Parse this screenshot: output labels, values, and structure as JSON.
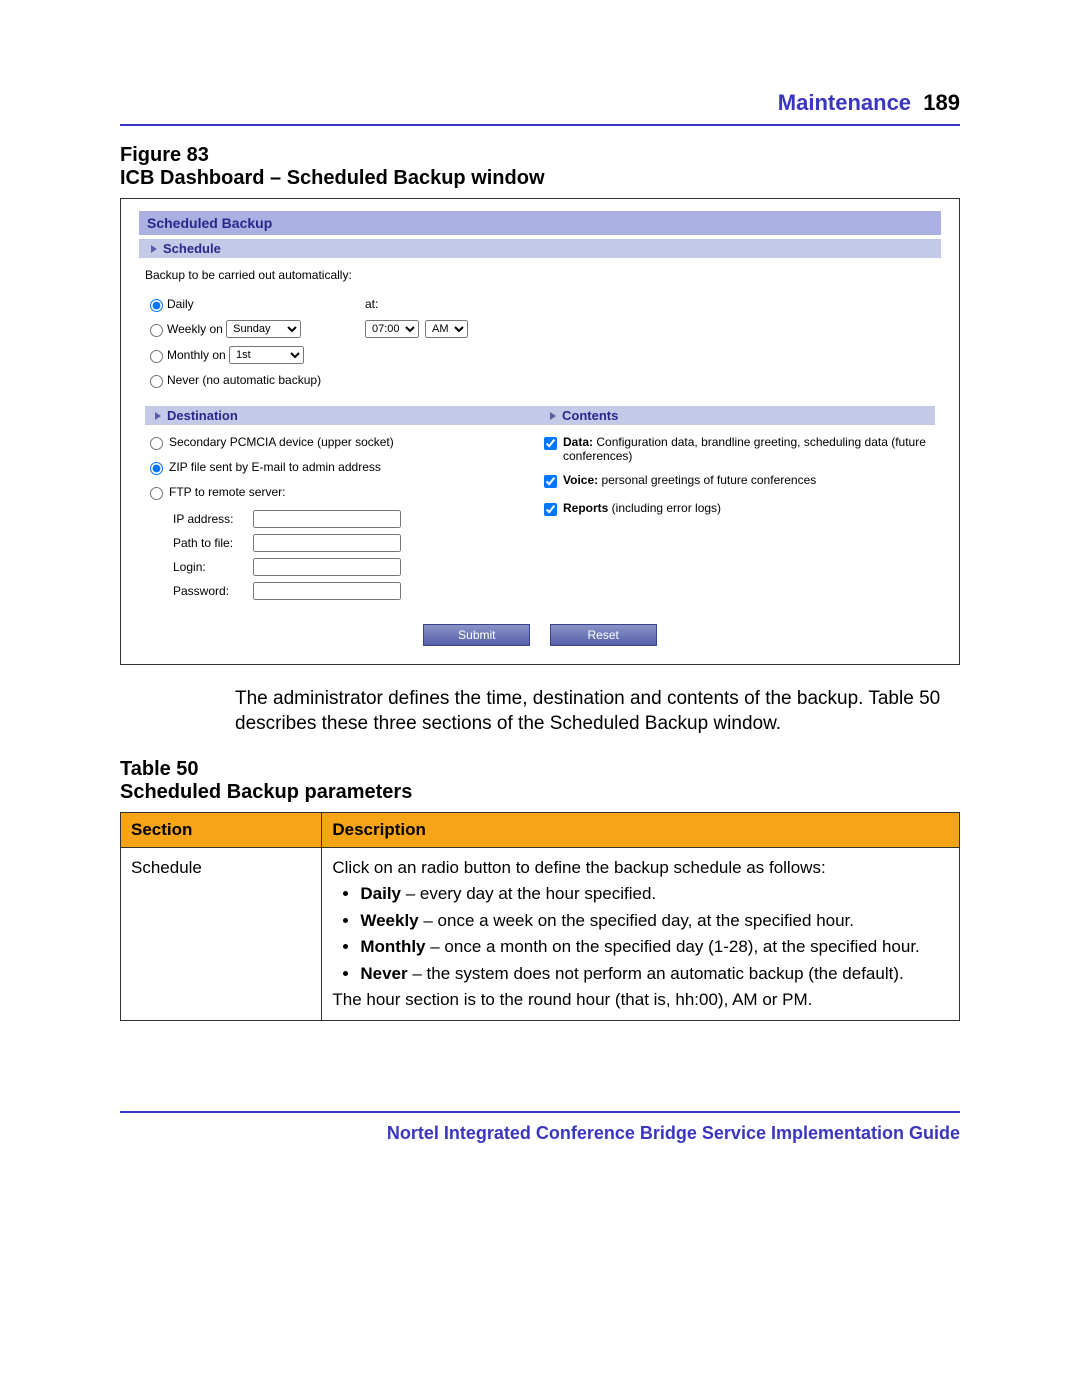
{
  "header": {
    "section": "Maintenance",
    "page_number": "189"
  },
  "figure": {
    "label": "Figure 83",
    "title": "ICB Dashboard – Scheduled Backup window"
  },
  "sb": {
    "title": "Scheduled Backup",
    "schedule_tab": "Schedule",
    "intro": "Backup to be carried out automatically:",
    "daily_label": "Daily",
    "at_label": "at:",
    "weekly_label": "Weekly on",
    "weekly_value": "Sunday",
    "time_value": "07:00",
    "ampm_value": "AM",
    "monthly_label": "Monthly on",
    "monthly_value": "1st",
    "never_label": "Never (no automatic backup)",
    "destination_tab": "Destination",
    "contents_tab": "Contents",
    "dest_pcmcia": "Secondary PCMCIA device (upper socket)",
    "dest_zip": "ZIP file sent by E-mail to admin address",
    "dest_ftp": " FTP to remote server:",
    "ftp_ip_label": "IP address:",
    "ftp_path_label": "Path to file:",
    "ftp_login_label": "Login:",
    "ftp_password_label": "Password:",
    "content_data_bold": "Data:",
    "content_data_rest": " Configuration data, brandline greeting, scheduling data (future conferences)",
    "content_voice_bold": "Voice:",
    "content_voice_rest": " personal greetings of future conferences",
    "content_reports_bold": "Reports",
    "content_reports_rest": " (including error logs)",
    "submit": "Submit",
    "reset": "Reset"
  },
  "para": "The administrator defines the time, destination and contents of the backup. Table 50 describes these three sections of the Scheduled Backup window.",
  "table": {
    "label": "Table 50",
    "title": "Scheduled Backup parameters",
    "h1": "Section",
    "h2": "Description",
    "row1_section": "Schedule",
    "row1_intro": "Click on an radio button to define the backup schedule as follows:",
    "row1_b1_bold": "Daily",
    "row1_b1_rest": " – every day at the hour specified.",
    "row1_b2_bold": "Weekly",
    "row1_b2_rest": " – once a week on the specified day, at the specified hour.",
    "row1_b3_bold": "Monthly",
    "row1_b3_rest": " – once a month on the specified day (1-28), at the specified hour.",
    "row1_b4_bold": "Never",
    "row1_b4_rest": " – the system does not perform an automatic backup (the default).",
    "row1_outro": "The hour section is to the round hour (that is, hh:00), AM or PM."
  },
  "footer": "Nortel Integrated Conference Bridge Service Implementation Guide"
}
